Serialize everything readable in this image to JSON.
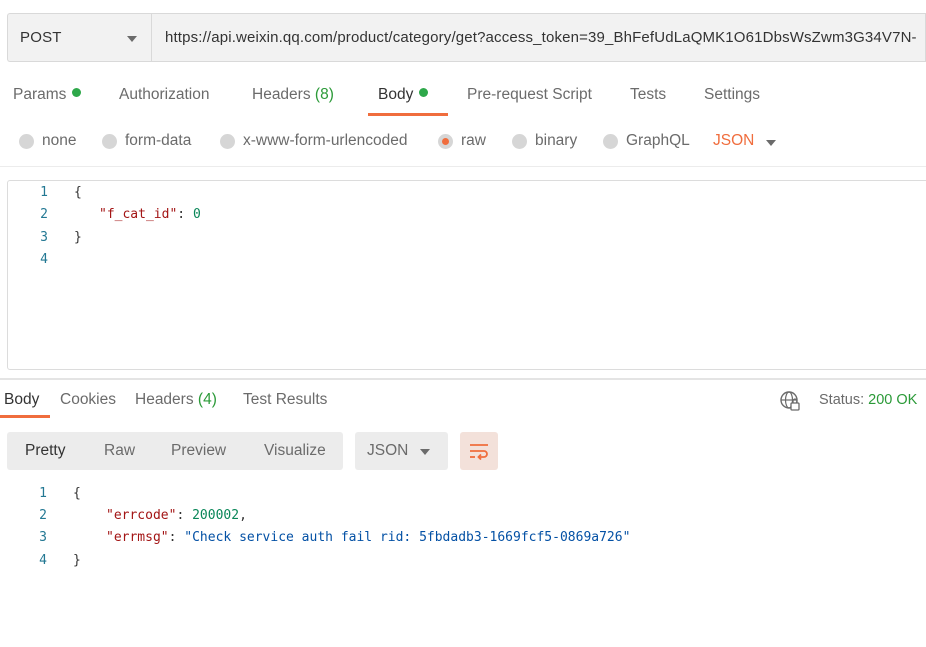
{
  "request": {
    "method": "POST",
    "url": "https://api.weixin.qq.com/product/category/get?access_token=39_BhFefUdLaQMK1O61DbsWsZwm3G34V7N-"
  },
  "request_tabs": {
    "params": "Params",
    "authorization": "Authorization",
    "headers": "Headers",
    "headers_count": "(8)",
    "body": "Body",
    "prerequest": "Pre-request Script",
    "tests": "Tests",
    "settings": "Settings"
  },
  "body_types": {
    "none": "none",
    "form_data": "form-data",
    "urlencoded": "x-www-form-urlencoded",
    "raw": "raw",
    "binary": "binary",
    "graphql": "GraphQL",
    "format": "JSON"
  },
  "request_body": {
    "line_numbers": [
      "1",
      "2",
      "3",
      "4"
    ],
    "open_brace": "{",
    "key": "\"f_cat_id\"",
    "colon": ": ",
    "value": "0",
    "close_brace": "}"
  },
  "response_tabs": {
    "body": "Body",
    "cookies": "Cookies",
    "headers": "Headers",
    "headers_count": "(4)",
    "test_results": "Test Results",
    "status_label": "Status:",
    "status_value": "200 OK"
  },
  "view_toolbar": {
    "pretty": "Pretty",
    "raw": "Raw",
    "preview": "Preview",
    "visualize": "Visualize",
    "format": "JSON"
  },
  "response_body": {
    "line_numbers": [
      "1",
      "2",
      "3",
      "4"
    ],
    "open_brace": "{",
    "key1": "\"errcode\"",
    "value1": "200002",
    "key2": "\"errmsg\"",
    "value2": "\"Check service auth fail rid: 5fbdadb3-1669fcf5-0869a726\"",
    "close_brace": "}"
  },
  "colors": {
    "accent": "#f06d3d",
    "success": "#2b9a38",
    "json_key": "#a31515",
    "json_number": "#098658",
    "json_string": "#0451a5",
    "line_number": "#237893"
  }
}
